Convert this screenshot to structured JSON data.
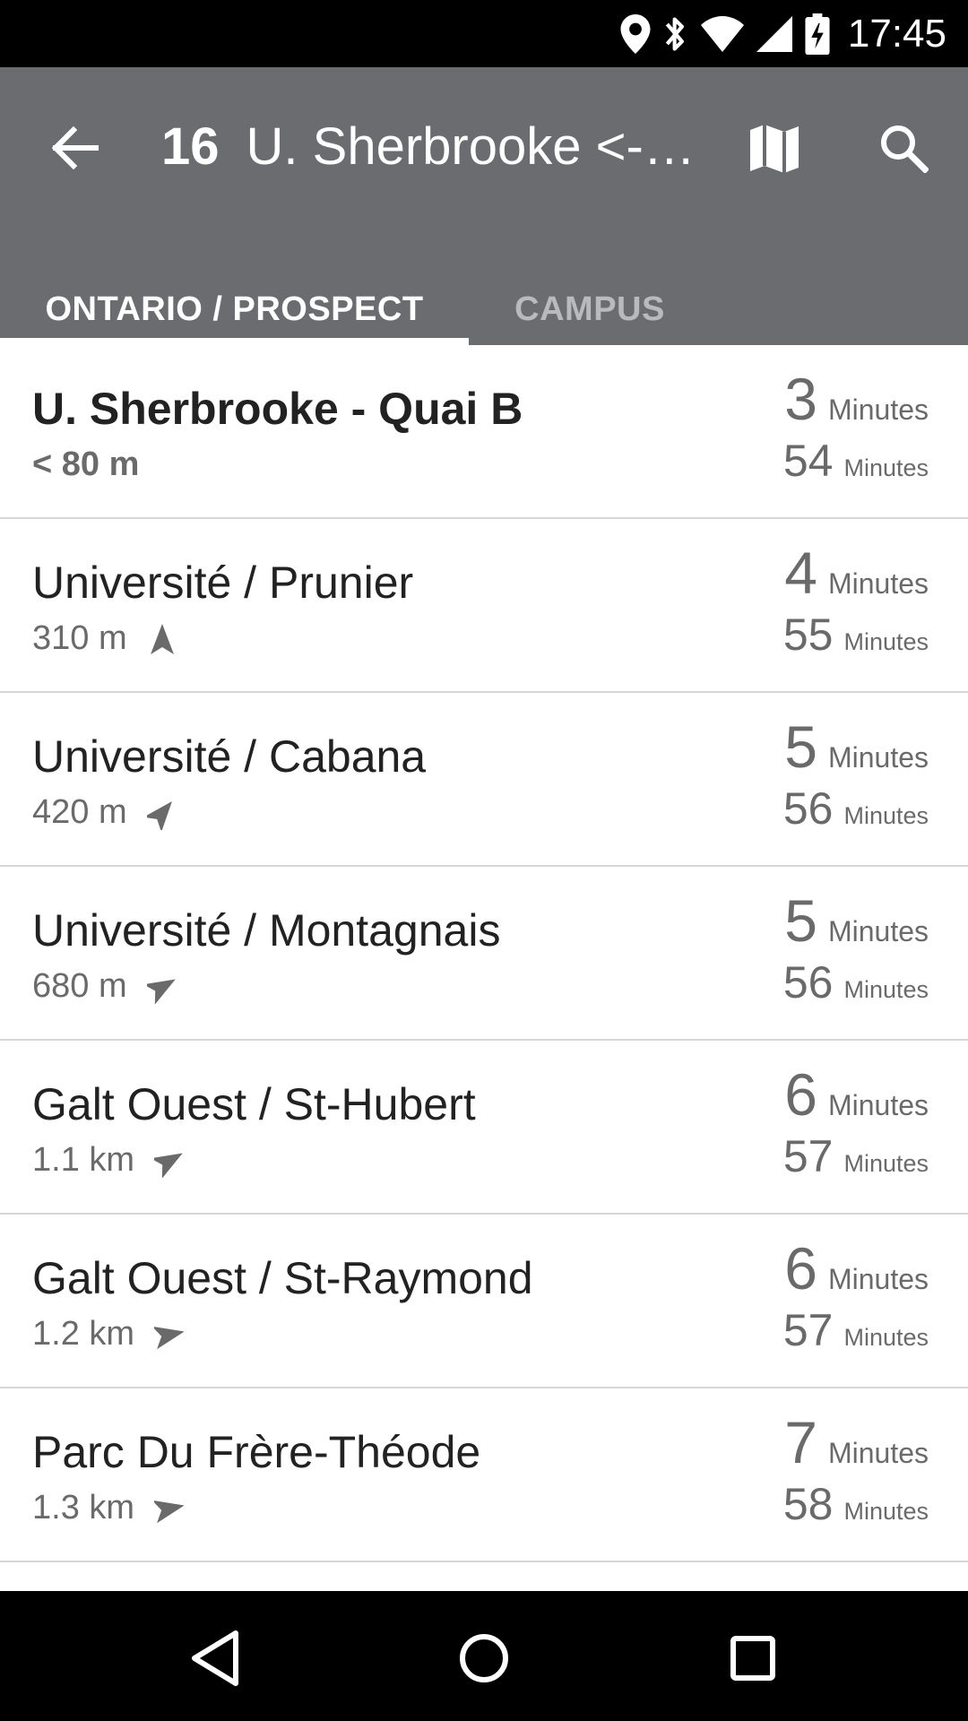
{
  "status_bar": {
    "time": "17:45",
    "icons": [
      "location-icon",
      "bluetooth-icon",
      "wifi-icon",
      "signal-icon",
      "battery-charging-icon"
    ]
  },
  "toolbar": {
    "route_number": "16",
    "route_name": "U. Sherbrooke <->…",
    "icons": [
      "back-arrow-icon",
      "map-icon",
      "search-icon"
    ]
  },
  "tabs": [
    {
      "label": "ONTARIO / PROSPECT",
      "selected": true
    },
    {
      "label": "CAMPUS",
      "selected": false
    }
  ],
  "stops": [
    {
      "name": "U. Sherbrooke - Quai B",
      "distance": "< 80 m",
      "bold": true,
      "arrow": "",
      "time1": "3",
      "unit1": "Minutes",
      "time2": "54",
      "unit2": "Minutes"
    },
    {
      "name": "Université / Prunier",
      "distance": "310 m",
      "bold": false,
      "arrow": "north",
      "time1": "4",
      "unit1": "Minutes",
      "time2": "55",
      "unit2": "Minutes"
    },
    {
      "name": "Université / Cabana",
      "distance": "420 m",
      "bold": false,
      "arrow": "northeast",
      "time1": "5",
      "unit1": "Minutes",
      "time2": "56",
      "unit2": "Minutes"
    },
    {
      "name": "Université / Montagnais",
      "distance": "680 m",
      "bold": false,
      "arrow": "east-northeast",
      "time1": "5",
      "unit1": "Minutes",
      "time2": "56",
      "unit2": "Minutes"
    },
    {
      "name": "Galt Ouest / St-Hubert",
      "distance": "1.1 km",
      "bold": false,
      "arrow": "east-northeast",
      "time1": "6",
      "unit1": "Minutes",
      "time2": "57",
      "unit2": "Minutes"
    },
    {
      "name": "Galt Ouest / St-Raymond",
      "distance": "1.2 km",
      "bold": false,
      "arrow": "east",
      "time1": "6",
      "unit1": "Minutes",
      "time2": "57",
      "unit2": "Minutes"
    },
    {
      "name": "Parc Du Frère-Théode",
      "distance": "1.3 km",
      "bold": false,
      "arrow": "east",
      "time1": "7",
      "unit1": "Minutes",
      "time2": "58",
      "unit2": "Minutes"
    }
  ],
  "colors": {
    "toolbar": "#6b6c70",
    "tab_inactive": "#b9babd",
    "divider": "#d6d6d6",
    "primary_text": "#222222",
    "secondary_text": "#6a6a6a"
  },
  "nav_bar": {
    "icons": [
      "nav-back-icon",
      "nav-home-icon",
      "nav-recent-icon"
    ]
  }
}
